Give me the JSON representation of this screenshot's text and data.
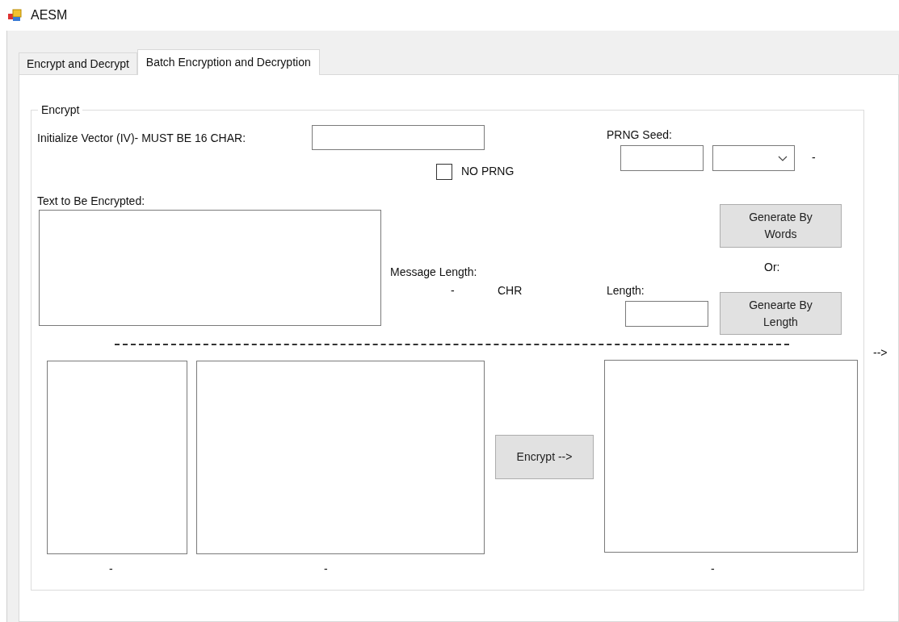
{
  "window": {
    "title": "AESM"
  },
  "tabs": [
    {
      "label": "Encrypt and Decrypt",
      "selected": false
    },
    {
      "label": "Batch Encryption and Decryption",
      "selected": true
    }
  ],
  "group": {
    "title": "Encrypt",
    "iv_label": "Initialize Vector (IV)- MUST BE 16 CHAR:",
    "no_prng": {
      "label": "NO PRNG",
      "checked": false
    },
    "prng_seed_label": "PRNG Seed:",
    "seed_suffix": "-",
    "text_label": "Text to Be Encrypted:",
    "message_length_label": "Message Length:",
    "message_length_value": "-",
    "message_length_unit": "CHR",
    "generate_words_button": "Generate By Words",
    "or_label": "Or:",
    "length_label": "Length:",
    "generate_length_button": "Genearte By Length",
    "encrypt_button": "Encrypt -->",
    "box_captions": [
      "-",
      "-",
      "-"
    ]
  },
  "side_arrow": "-->"
}
